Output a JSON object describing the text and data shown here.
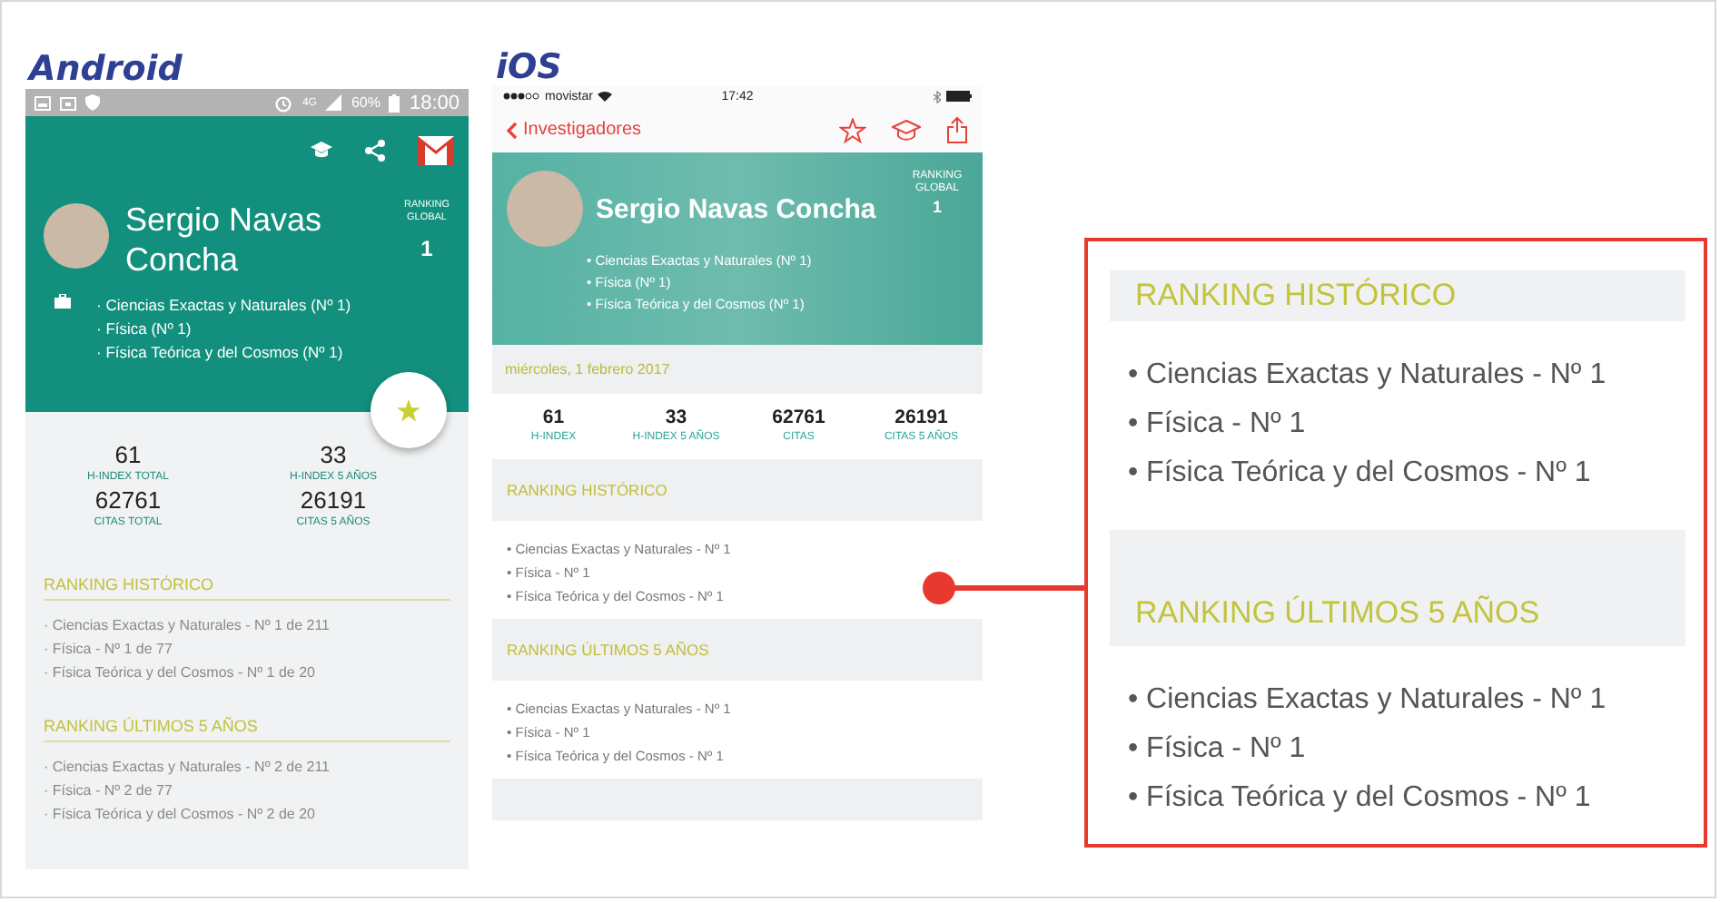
{
  "android": {
    "label": "Android",
    "status_bar": {
      "network": "4G",
      "battery": "60%",
      "time": "18:00"
    },
    "name": "Sergio Navas Concha",
    "ranking_global": {
      "label": "RANKING GLOBAL",
      "value": "1"
    },
    "areas": [
      "· Ciencias Exactas y Naturales (Nº 1)",
      "· Física (Nº 1)",
      "· Física Teórica y del Cosmos (Nº 1)"
    ],
    "stats": [
      {
        "value": "61",
        "label": "H-INDEX TOTAL"
      },
      {
        "value": "33",
        "label": "H-INDEX 5 AÑOS"
      },
      {
        "value": "62761",
        "label": "CITAS TOTAL"
      },
      {
        "value": "26191",
        "label": "CITAS 5 AÑOS"
      }
    ],
    "sections": [
      {
        "title": "RANKING HISTÓRICO",
        "items": [
          "· Ciencias Exactas y Naturales - Nº 1 de 211",
          "· Física - Nº 1 de 77",
          "· Física Teórica y del Cosmos - Nº 1 de 20"
        ]
      },
      {
        "title": "RANKING ÚLTIMOS 5 AÑOS",
        "items": [
          "· Ciencias Exactas y Naturales - Nº 2 de 211",
          "· Física - Nº 2 de 77",
          "· Física Teórica y del Cosmos - Nº 2 de 20"
        ]
      }
    ]
  },
  "ios": {
    "label": "iOS",
    "status_bar": {
      "carrier": "movistar",
      "time": "17:42"
    },
    "back": "Investigadores",
    "name": "Sergio Navas Concha",
    "ranking_global": {
      "label": "RANKING GLOBAL",
      "value": "1"
    },
    "areas": [
      "• Ciencias Exactas y Naturales (Nº 1)",
      "• Física (Nº 1)",
      "• Física Teórica y del Cosmos (Nº 1)"
    ],
    "date": "miércoles, 1 febrero 2017",
    "stats": [
      {
        "value": "61",
        "label": "H-INDEX"
      },
      {
        "value": "33",
        "label": "H-INDEX 5 AÑOS"
      },
      {
        "value": "62761",
        "label": "CITAS"
      },
      {
        "value": "26191",
        "label": "CITAS 5 AÑOS"
      }
    ],
    "sections": [
      {
        "title": "RANKING HISTÓRICO",
        "items": [
          "• Ciencias Exactas y Naturales - Nº 1",
          "• Física - Nº 1",
          "• Física Teórica y del Cosmos - Nº 1"
        ]
      },
      {
        "title": "RANKING ÚLTIMOS 5 AÑOS",
        "items": [
          "• Ciencias Exactas y Naturales - Nº 1",
          "• Física - Nº 1",
          "• Física Teórica y del Cosmos - Nº 1"
        ]
      }
    ]
  },
  "zoom": {
    "sections": [
      {
        "title": "RANKING HISTÓRICO",
        "items": [
          "• Ciencias Exactas y Naturales - Nº 1",
          "• Física - Nº 1",
          "• Física Teórica y del Cosmos - Nº 1"
        ]
      },
      {
        "title": "RANKING ÚLTIMOS 5 AÑOS",
        "items": [
          "• Ciencias Exactas y Naturales - Nº 1",
          "• Física - Nº 1",
          "• Física Teórica y del Cosmos - Nº 1"
        ]
      }
    ]
  }
}
